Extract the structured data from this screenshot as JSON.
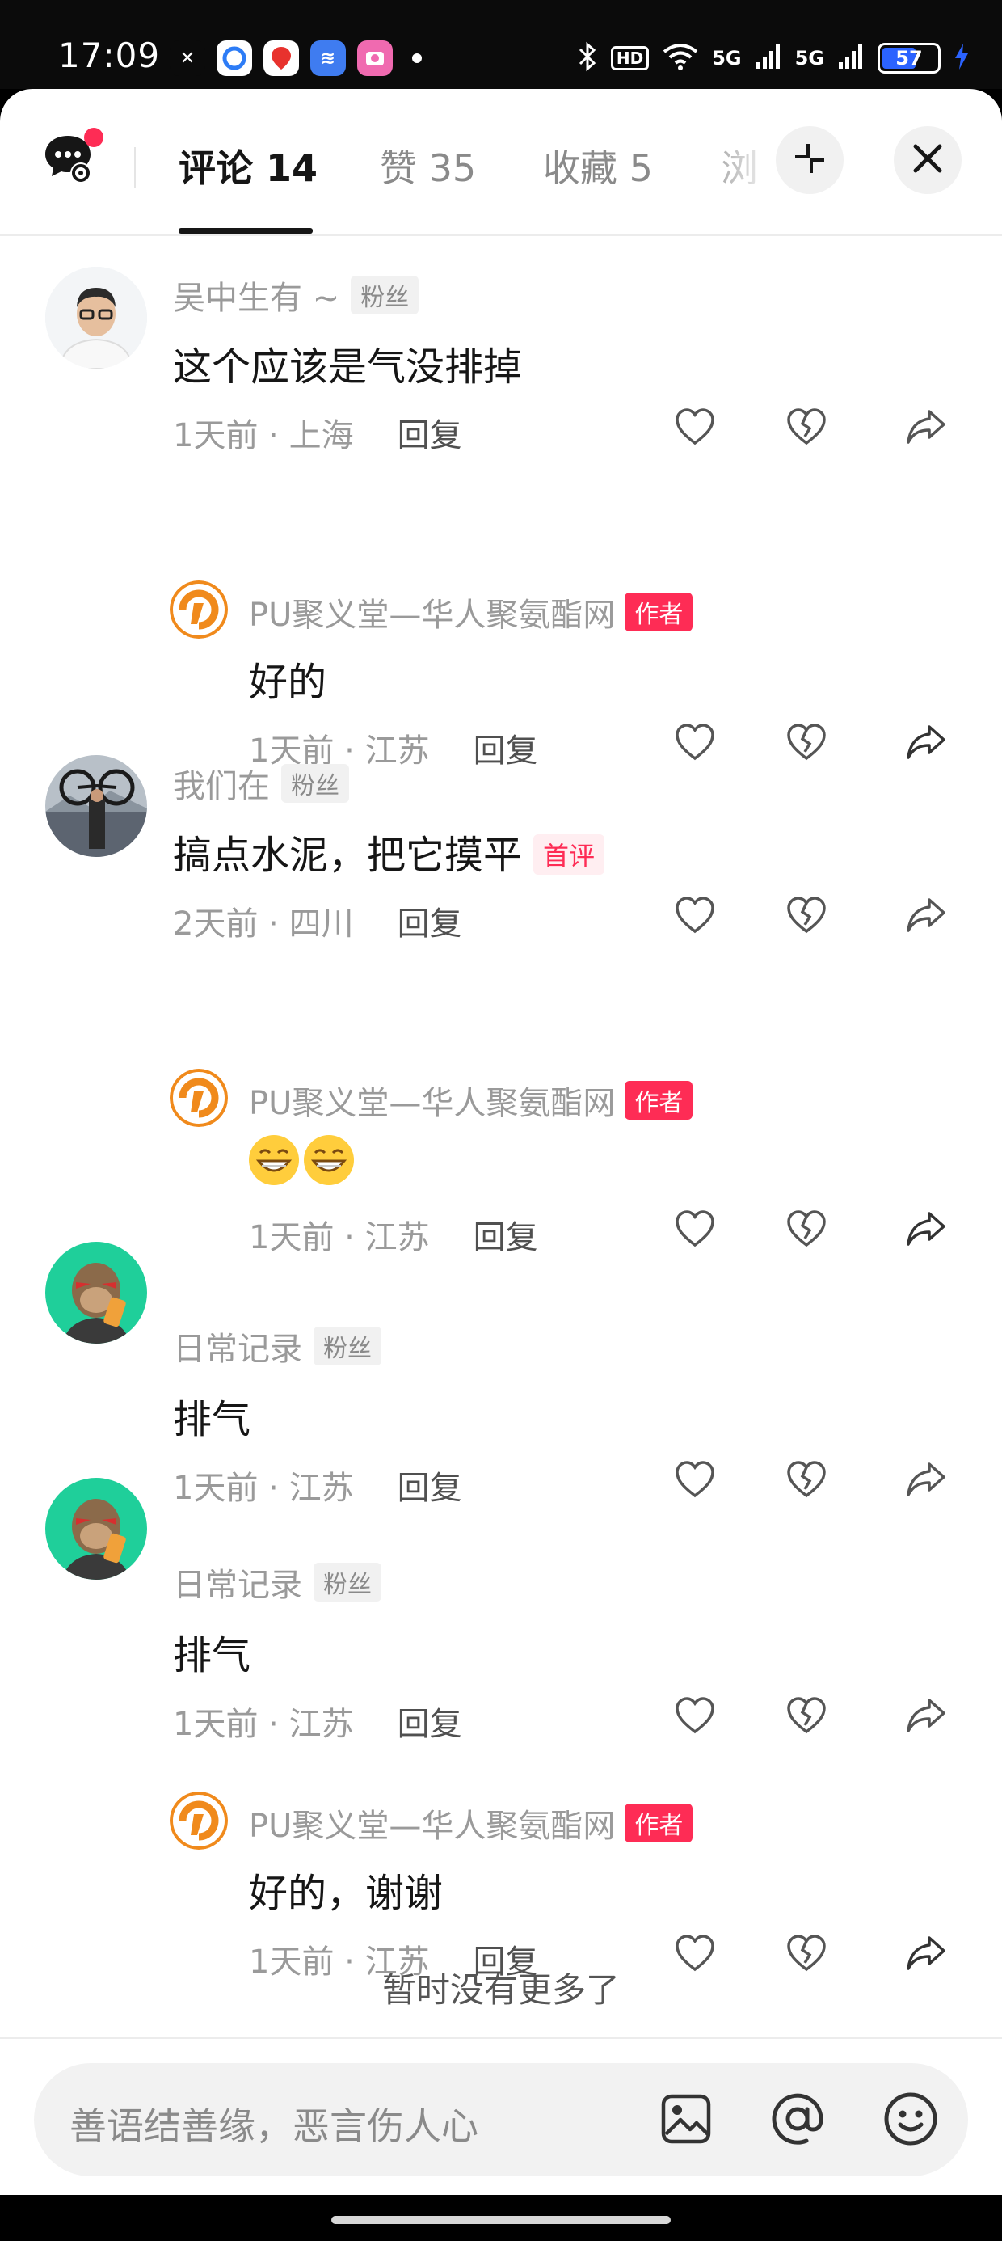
{
  "status_bar": {
    "time": "17:09",
    "battery_level": "57",
    "hd_label": "HD",
    "net1": "5G",
    "net2": "5G",
    "icons": [
      "app-icon-1",
      "app-icon-2",
      "app-icon-3",
      "app-icon-4",
      "app-icon-5",
      "bluetooth-icon",
      "wifi-icon",
      "signal-icon",
      "charging-icon"
    ]
  },
  "header": {
    "tabs": [
      {
        "label": "评论 14",
        "active": true
      },
      {
        "label": "赞 35",
        "active": false
      },
      {
        "label": "收藏 5",
        "active": false
      },
      {
        "label": "浏",
        "active": false
      }
    ],
    "icons": [
      "comment-settings-icon",
      "collapse-icon",
      "close-icon"
    ]
  },
  "comments": [
    {
      "user": "吴中生有 ~",
      "badge": "粉丝",
      "text": "这个应该是气没排掉",
      "meta": "1天前 · 上海",
      "reply_label": "回复",
      "replies": [
        {
          "user": "PU聚义堂—华人聚氨酯网",
          "badge": "作者",
          "text": "好的",
          "meta": "1天前 · 江苏",
          "reply_label": "回复"
        }
      ]
    },
    {
      "user": "我们在",
      "badge": "粉丝",
      "text": "搞点水泥，把它摸平",
      "tag": "首评",
      "meta": "2天前 · 四川",
      "reply_label": "回复",
      "replies": [
        {
          "user": "PU聚义堂—华人聚氨酯网",
          "badge": "作者",
          "text": "grinning-emoji x2",
          "meta": "1天前 · 江苏",
          "reply_label": "回复"
        }
      ]
    },
    {
      "user": "日常记录",
      "badge": "粉丝",
      "text": "排气",
      "meta": "1天前 · 江苏",
      "reply_label": "回复",
      "replies": []
    },
    {
      "user": "日常记录",
      "badge": "粉丝",
      "text": "排气",
      "meta": "1天前 · 江苏",
      "reply_label": "回复",
      "replies": [
        {
          "user": "PU聚义堂—华人聚氨酯网",
          "badge": "作者",
          "text": "好的，谢谢",
          "meta": "1天前 · 江苏",
          "reply_label": "回复"
        }
      ]
    }
  ],
  "footer": {
    "no_more": "暂时没有更多了",
    "input_placeholder": "善语结善缘，恶言伤人心"
  },
  "colors": {
    "accent": "#fe2c55",
    "text": "#161616",
    "muted": "#9a9a9a"
  }
}
